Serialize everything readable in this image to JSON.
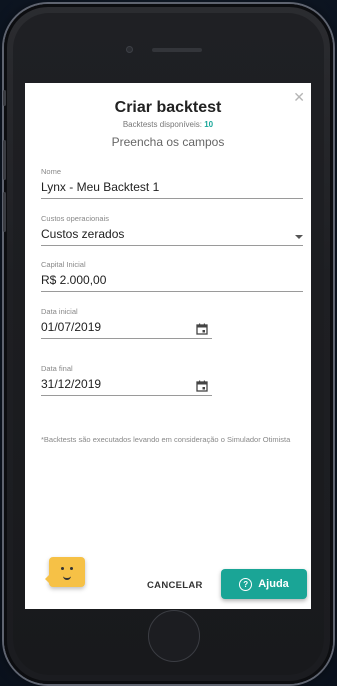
{
  "dialog": {
    "title": "Criar backtest",
    "available_label": "Backtests disponíveis:",
    "available_count": "10",
    "subtitle": "Preencha os campos",
    "close_icon": "close-icon"
  },
  "fields": {
    "name": {
      "label": "Nome",
      "value": "Lynx - Meu Backtest 1"
    },
    "costs": {
      "label": "Custos operacionais",
      "value": "Custos zerados"
    },
    "capital": {
      "label": "Capital Inicial",
      "value": "R$ 2.000,00"
    },
    "start_date": {
      "label": "Data inicial",
      "value": "01/07/2019"
    },
    "end_date": {
      "label": "Data final",
      "value": "31/12/2019"
    }
  },
  "note": "*Backtests são executados levando em consideração o Simulador Otimista",
  "actions": {
    "cancel_label": "CANCELAR",
    "help_label": "Ajuda"
  },
  "colors": {
    "accent": "#1aa596",
    "mascot": "#f6c146"
  }
}
